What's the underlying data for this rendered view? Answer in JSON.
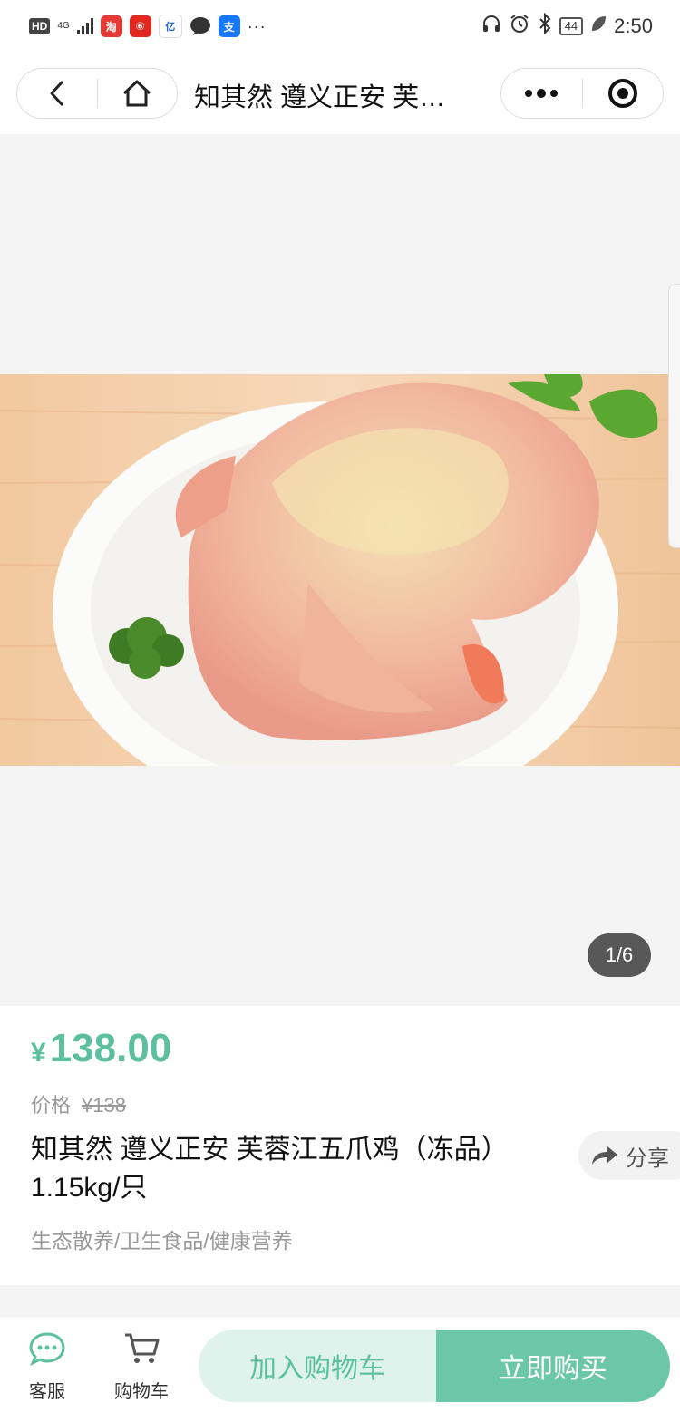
{
  "status_bar": {
    "hd": "HD",
    "network": "4G",
    "app_icons": [
      {
        "name": "shopping-app-icon",
        "color": "#e53935",
        "glyph": "淘"
      },
      {
        "name": "music-app-icon",
        "color": "#e0281e",
        "glyph": "⑥"
      },
      {
        "name": "yizhan-app-icon",
        "color": "#ffffff",
        "glyph": "亿"
      },
      {
        "name": "wechat-app-icon",
        "color": "#333333",
        "glyph": "💬"
      },
      {
        "name": "alipay-app-icon",
        "color": "#1677ff",
        "glyph": "支"
      }
    ],
    "more": "···",
    "battery": "44",
    "time": "2:50"
  },
  "nav": {
    "title": "知其然 遵义正安 芙…"
  },
  "gallery": {
    "counter": "1/6"
  },
  "product": {
    "currency": "¥",
    "price": "138.00",
    "original_label": "价格",
    "original_price": "¥138",
    "title": "知其然 遵义正安 芙蓉江五爪鸡（冻品）1.15kg/只",
    "tags": "生态散养/卫生食品/健康营养",
    "share_label": "分享"
  },
  "bottom_bar": {
    "service_label": "客服",
    "cart_label": "购物车",
    "add_to_cart": "加入购物车",
    "buy_now": "立即购买"
  },
  "colors": {
    "accent": "#5cc0a0",
    "buy_button": "#6cc7a8",
    "cart_button_bg": "#dff3ec"
  }
}
